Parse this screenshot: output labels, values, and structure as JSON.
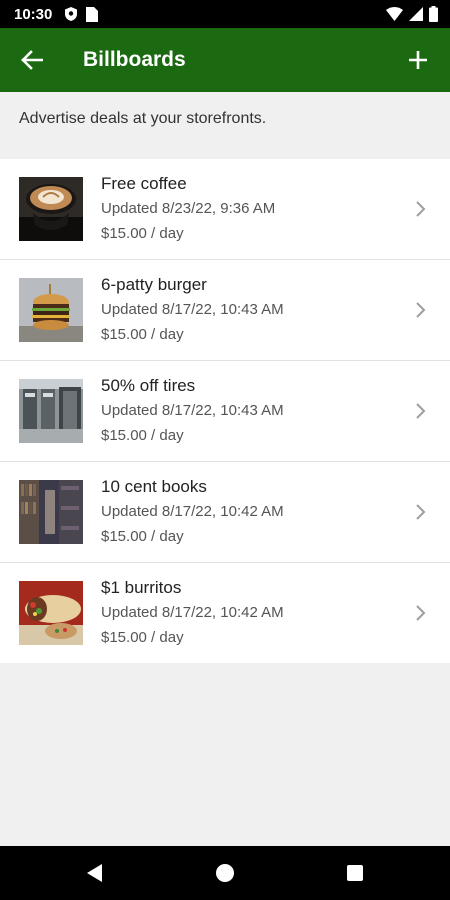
{
  "status_bar": {
    "time": "10:30",
    "icons": [
      "shield-icon",
      "sim-card-icon",
      "wifi-icon",
      "signal-icon",
      "battery-icon"
    ]
  },
  "app_bar": {
    "title": "Billboards",
    "background": "#1b6a12",
    "back_icon": "arrow-left-icon",
    "add_icon": "plus-icon"
  },
  "description": "Advertise deals at your storefronts.",
  "billboards": [
    {
      "title": "Free coffee",
      "updated": "Updated 8/23/22, 9:36 AM",
      "price": "$15.00 / day",
      "thumbnail": "coffee-image"
    },
    {
      "title": "6-patty burger",
      "updated": "Updated 8/17/22, 10:43 AM",
      "price": "$15.00 / day",
      "thumbnail": "burger-image"
    },
    {
      "title": "50% off tires",
      "updated": "Updated 8/17/22, 10:43 AM",
      "price": "$15.00 / day",
      "thumbnail": "tire-shop-image"
    },
    {
      "title": "10 cent books",
      "updated": "Updated 8/17/22, 10:42 AM",
      "price": "$15.00 / day",
      "thumbnail": "bookshelf-image"
    },
    {
      "title": "$1 burritos",
      "updated": "Updated 8/17/22, 10:42 AM",
      "price": "$15.00 / day",
      "thumbnail": "burrito-image"
    }
  ],
  "nav_bar": {
    "buttons": [
      "back-triangle-icon",
      "home-circle-icon",
      "recents-square-icon"
    ]
  }
}
